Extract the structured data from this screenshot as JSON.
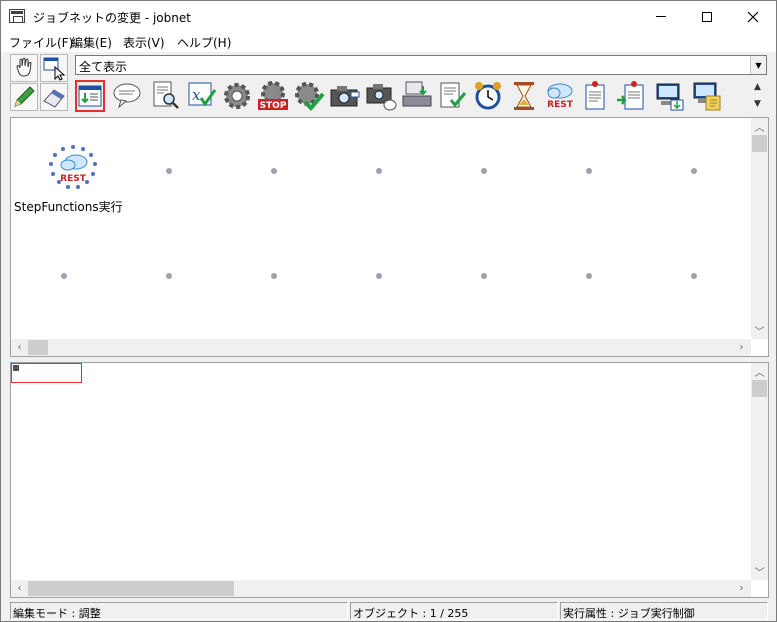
{
  "window": {
    "title": "ジョブネットの変更 - jobnet"
  },
  "menu": {
    "items": [
      "ファイル(F)",
      "編集(E)",
      "表示(V)",
      "ヘルプ(H)"
    ]
  },
  "toolbar": {
    "filter_value": "全て表示",
    "icons": [
      "job-list-icon",
      "comment-icon",
      "document-search-icon",
      "variable-check-icon",
      "gear-icon",
      "stop-gear-icon",
      "gear-check-icon",
      "camera-icon",
      "camera-message-icon",
      "file-transfer-icon",
      "document-check-icon",
      "alarm-clock-icon",
      "hourglass-icon",
      "rest-cloud-icon",
      "document-pin-icon",
      "document-pin-arrow-icon",
      "computer-download-icon",
      "computer-file-icon"
    ]
  },
  "canvas": {
    "job": {
      "label": "StepFunctions実行",
      "badge": "REST"
    }
  },
  "status": {
    "mode": "編集モード : 調整",
    "objects": "オブジェクト : 1 / 255",
    "attribute": "実行属性 : ジョブ実行制御"
  },
  "colors": {
    "selection": "#e03030",
    "rest_red": "#d22020",
    "cloud_blue": "#3a8fd8",
    "grid_dot": "#a0a0b0"
  }
}
